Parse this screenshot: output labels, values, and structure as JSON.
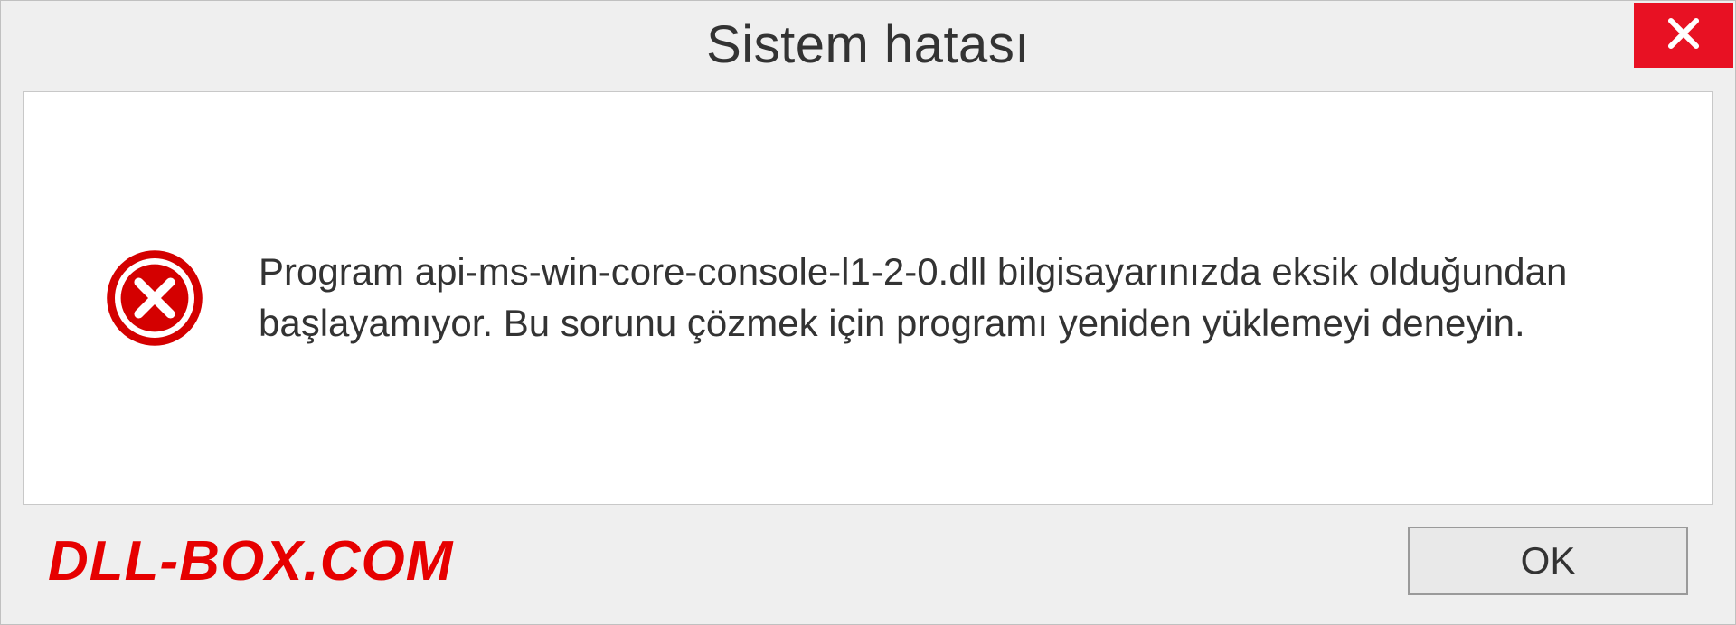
{
  "titlebar": {
    "title": "Sistem hatası"
  },
  "body": {
    "message": "Program api-ms-win-core-console-l1-2-0.dll bilgisayarınızda eksik olduğundan başlayamıyor. Bu sorunu çözmek için programı yeniden yüklemeyi deneyin."
  },
  "footer": {
    "watermark": "DLL-BOX.COM",
    "ok_label": "OK"
  },
  "colors": {
    "close_bg": "#e81123",
    "error_red": "#d40000",
    "watermark_red": "#e60000"
  }
}
